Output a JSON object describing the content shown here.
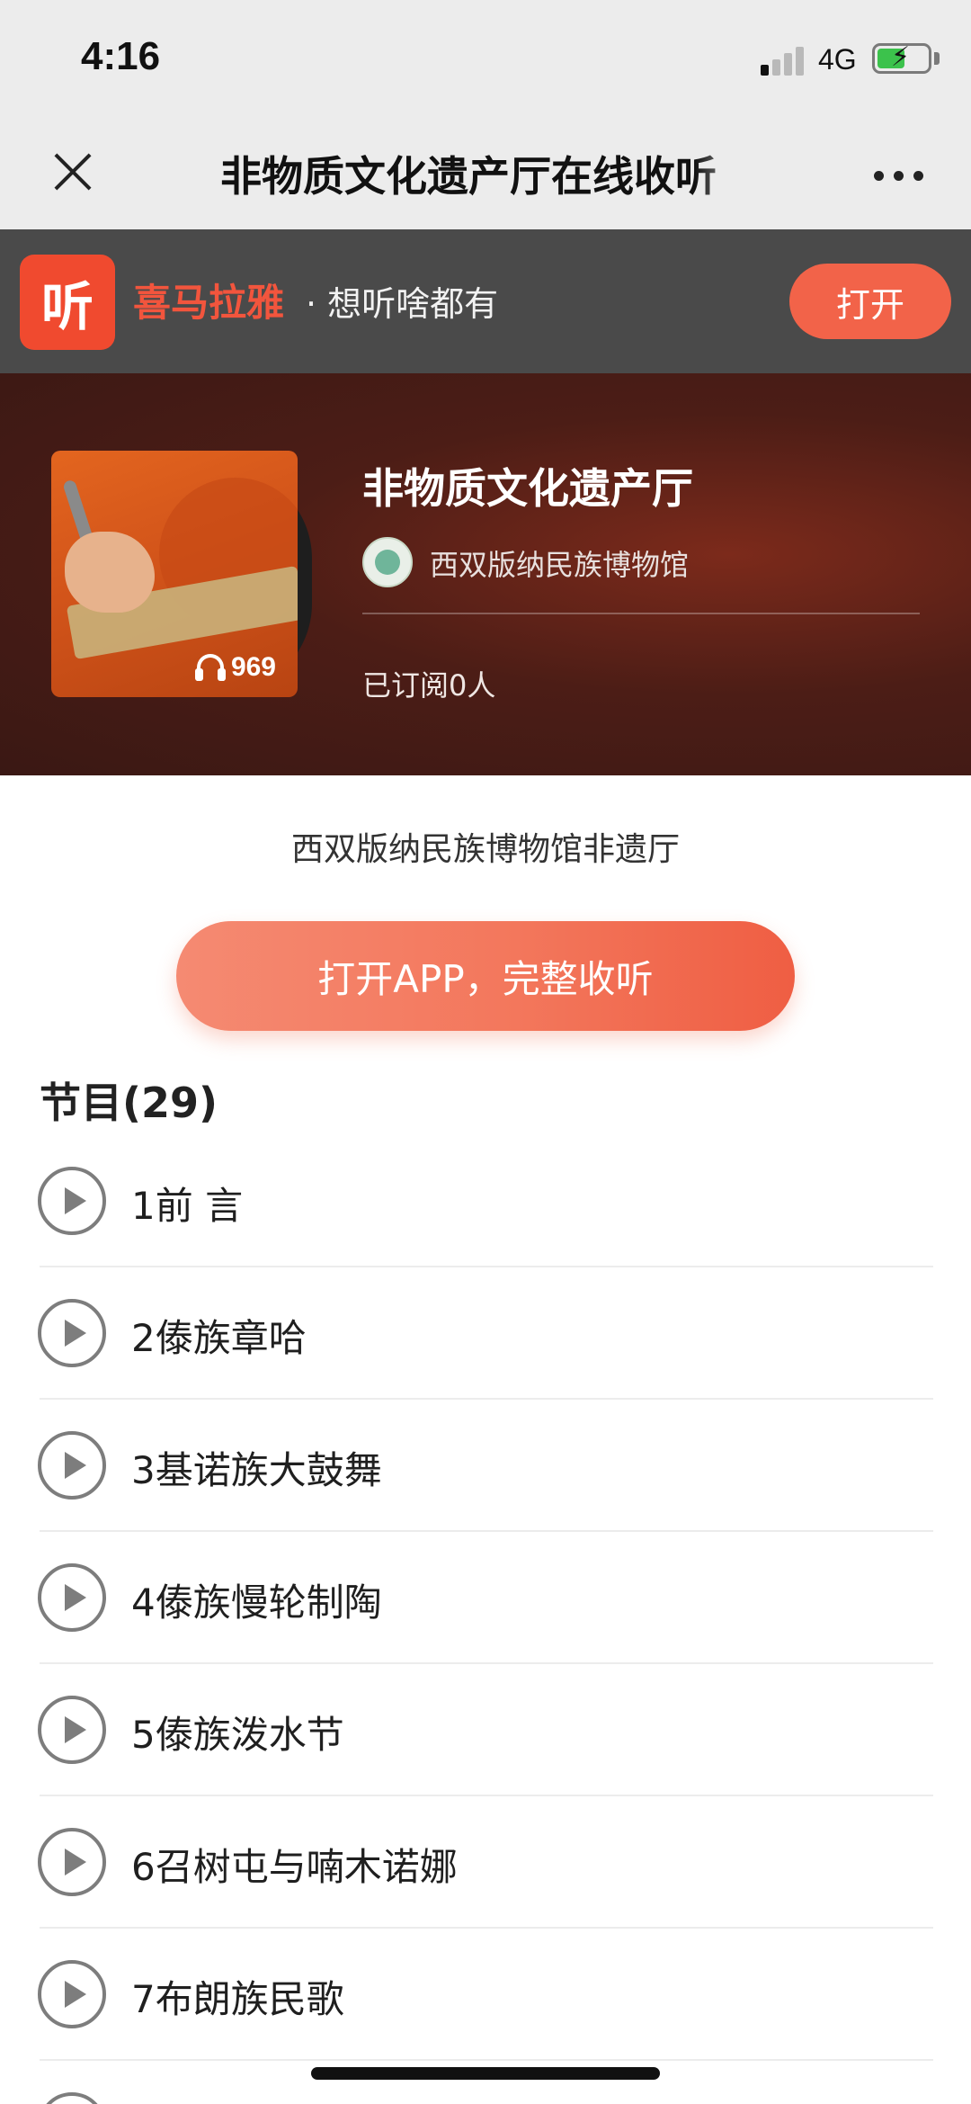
{
  "status_bar": {
    "time": "4:16",
    "network": "4G",
    "signal_bars_active": 1,
    "battery_charging": true
  },
  "nav": {
    "title": "非物质文化遗产厅在线收听",
    "close_icon": "close-icon",
    "more_icon": "more-icon"
  },
  "banner": {
    "logo_text": "听",
    "brand": "喜马拉雅",
    "slogan": "· 想听啥都有",
    "open_label": "打开",
    "brand_color": "#f04a2f"
  },
  "album": {
    "title": "非物质文化遗产厅",
    "author": "西双版纳民族博物馆",
    "play_count": "969",
    "subscribers": "已订阅0人",
    "description": "西双版纳民族博物馆非遗厅"
  },
  "cta": {
    "label": "打开APP，完整收听"
  },
  "episodes": {
    "heading": "节目(29)",
    "items": [
      {
        "label": "1前 言"
      },
      {
        "label": "2傣族章哈"
      },
      {
        "label": "3基诺族大鼓舞"
      },
      {
        "label": "4傣族慢轮制陶"
      },
      {
        "label": "5傣族泼水节"
      },
      {
        "label": "6召树屯与喃木诺娜"
      },
      {
        "label": "7布朗族民歌"
      }
    ]
  }
}
